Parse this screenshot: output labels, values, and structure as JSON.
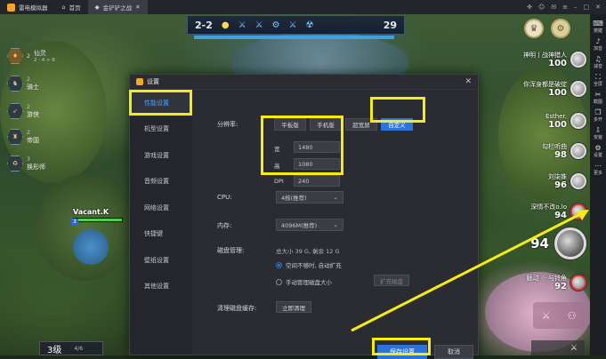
{
  "emulator": {
    "app_title": "雷电模拟器",
    "tabs": [
      {
        "label": "首页"
      },
      {
        "label": "金铲铲之战"
      }
    ],
    "right_toolbar": [
      {
        "icon": "keyboard-icon",
        "label": "按键"
      },
      {
        "icon": "volume-up-icon",
        "label": "加音"
      },
      {
        "icon": "volume-down-icon",
        "label": "减音"
      },
      {
        "icon": "fullscreen-icon",
        "label": "全屏"
      },
      {
        "icon": "scissors-icon",
        "label": "截图"
      },
      {
        "icon": "multi-window-icon",
        "label": "多开"
      },
      {
        "icon": "install-icon",
        "label": "安装"
      },
      {
        "icon": "gear-icon",
        "label": "设置"
      },
      {
        "icon": "more-icon",
        "label": "更多"
      }
    ]
  },
  "game": {
    "score_left": "2-2",
    "score_right": "29",
    "player_level_label": "仙灵",
    "player_level_count": "2 - 4 > 6",
    "traits": [
      {
        "name": "骑士",
        "count": "2"
      },
      {
        "name": "游侠",
        "count": "2"
      },
      {
        "name": "帝国",
        "count": "2"
      },
      {
        "name": "换形师",
        "count": "3"
      }
    ],
    "unit_name": "Vacant.K",
    "unit_level": "3",
    "level_label": "3级",
    "xp": "4/6",
    "scoreboard": [
      {
        "name": "神明丨战神猎人",
        "hp": "100"
      },
      {
        "name": "你浑身都是破绽",
        "hp": "100"
      },
      {
        "name": "Esther.",
        "hp": "100"
      },
      {
        "name": "勾栏听曲",
        "hp": "98"
      },
      {
        "name": "刘柒姝",
        "hp": "96"
      },
      {
        "name": "深情不改o.lo",
        "hp": "94"
      },
      {
        "name": "",
        "hp": "94"
      },
      {
        "name": "腼动 ⊹ 与铃角",
        "hp": "92"
      }
    ]
  },
  "settings": {
    "title": "设置",
    "nav": [
      "性能设置",
      "机型设置",
      "游戏设置",
      "音频设置",
      "网络设置",
      "快捷键",
      "壁纸设置",
      "其他设置"
    ],
    "resolution_label": "分辨率:",
    "resolution_tabs": [
      "平板版",
      "手机版",
      "超宽屏",
      "自定义"
    ],
    "width_label": "宽",
    "width_value": "1480",
    "height_label": "高",
    "height_value": "1080",
    "dpi_label": "DPI",
    "dpi_value": "240",
    "cpu_label": "CPU:",
    "cpu_value": "4核(推荐)",
    "memory_label": "内存:",
    "memory_value": "4096M(推荐)",
    "disk_label": "磁盘管理:",
    "disk_info": "总大小 39 G, 剩余 12 G",
    "disk_option_1": "空间不够时, 自动扩充",
    "disk_option_2": "手动管理磁盘大小",
    "expand_button": "扩充磁盘",
    "cache_label": "清理磁盘缓存:",
    "cache_button": "立即清理",
    "save_button": "保存设置",
    "cancel_button": "取消",
    "close_glyph": "✕"
  },
  "annotation_color": "#f6ec12"
}
